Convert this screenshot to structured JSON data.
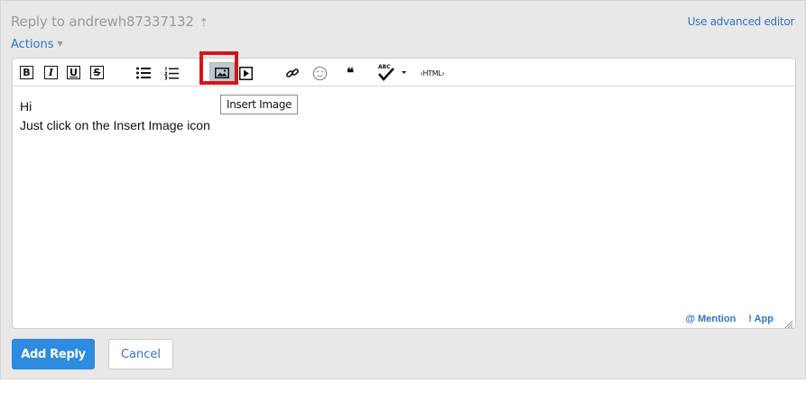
{
  "header": {
    "title": "Reply to andrewh87337132",
    "title_arrow": "⇡",
    "advanced_link": "Use advanced editor"
  },
  "actions": {
    "label": "Actions",
    "caret": "▼"
  },
  "toolbar": {
    "bold": "B",
    "italic": "I",
    "underline": "U",
    "strike": "S",
    "quote": "❝",
    "html": "‹HTML›",
    "tooltip": "Insert Image",
    "icons": [
      "bold-icon",
      "italic-icon",
      "underline-icon",
      "strikethrough-icon",
      "bullet-list-icon",
      "numbered-list-icon",
      "insert-image-icon",
      "insert-video-icon",
      "link-icon",
      "emoji-icon",
      "quote-icon",
      "spell-check-icon",
      "html-icon"
    ]
  },
  "content": {
    "lines": [
      "Hi",
      "Just click on the Insert Image icon"
    ]
  },
  "footer": {
    "mention": "@ Mention",
    "app": "! App"
  },
  "buttons": {
    "add_reply": "Add Reply",
    "cancel": "Cancel"
  },
  "colors": {
    "accent": "#2e76c7",
    "primary_button": "#2d8be0",
    "highlight": "#d7141a"
  }
}
